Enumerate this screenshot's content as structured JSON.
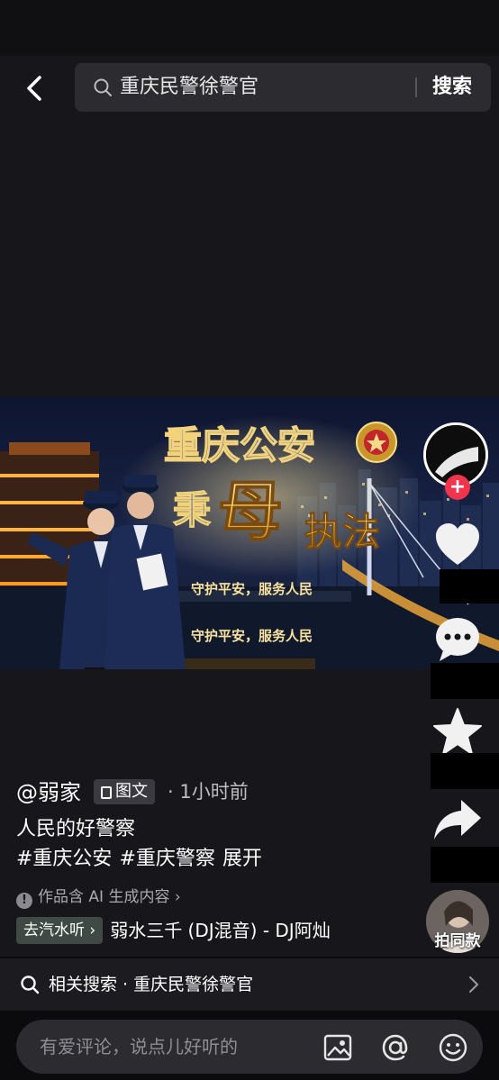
{
  "search": {
    "query": "重庆民警徐警官",
    "button": "搜索"
  },
  "banner": {
    "title_1": "重庆公安",
    "title_2": "秉",
    "title_3": "母",
    "title_4": "执法",
    "slogan_1": "守护平安，服务人民",
    "slogan_2": "守护平安，服务人民"
  },
  "post": {
    "author": "@弱家",
    "type_tag": "图文",
    "time": "· 1小时前",
    "caption": "人民的好警察",
    "hashtags": [
      "#重庆公安",
      "#重庆警察"
    ],
    "expand": "展开",
    "ai_notice": "作品含 AI 生成内容 ›",
    "music_chip": "去汽水听 ›",
    "music_title": "弱水三千 (DJ混音) - DJ阿灿"
  },
  "side": {
    "follow_symbol": "+",
    "same_style": "拍同款"
  },
  "related": {
    "text": "相关搜索 · 重庆民警徐警官"
  },
  "comment": {
    "placeholder": "有爱评论，说点儿好听的"
  },
  "icons": [
    "back-icon",
    "search-icon",
    "heart-icon",
    "comment-icon",
    "star-icon",
    "share-icon",
    "image-icon",
    "at-icon",
    "emoji-icon",
    "chevron-right-icon"
  ]
}
